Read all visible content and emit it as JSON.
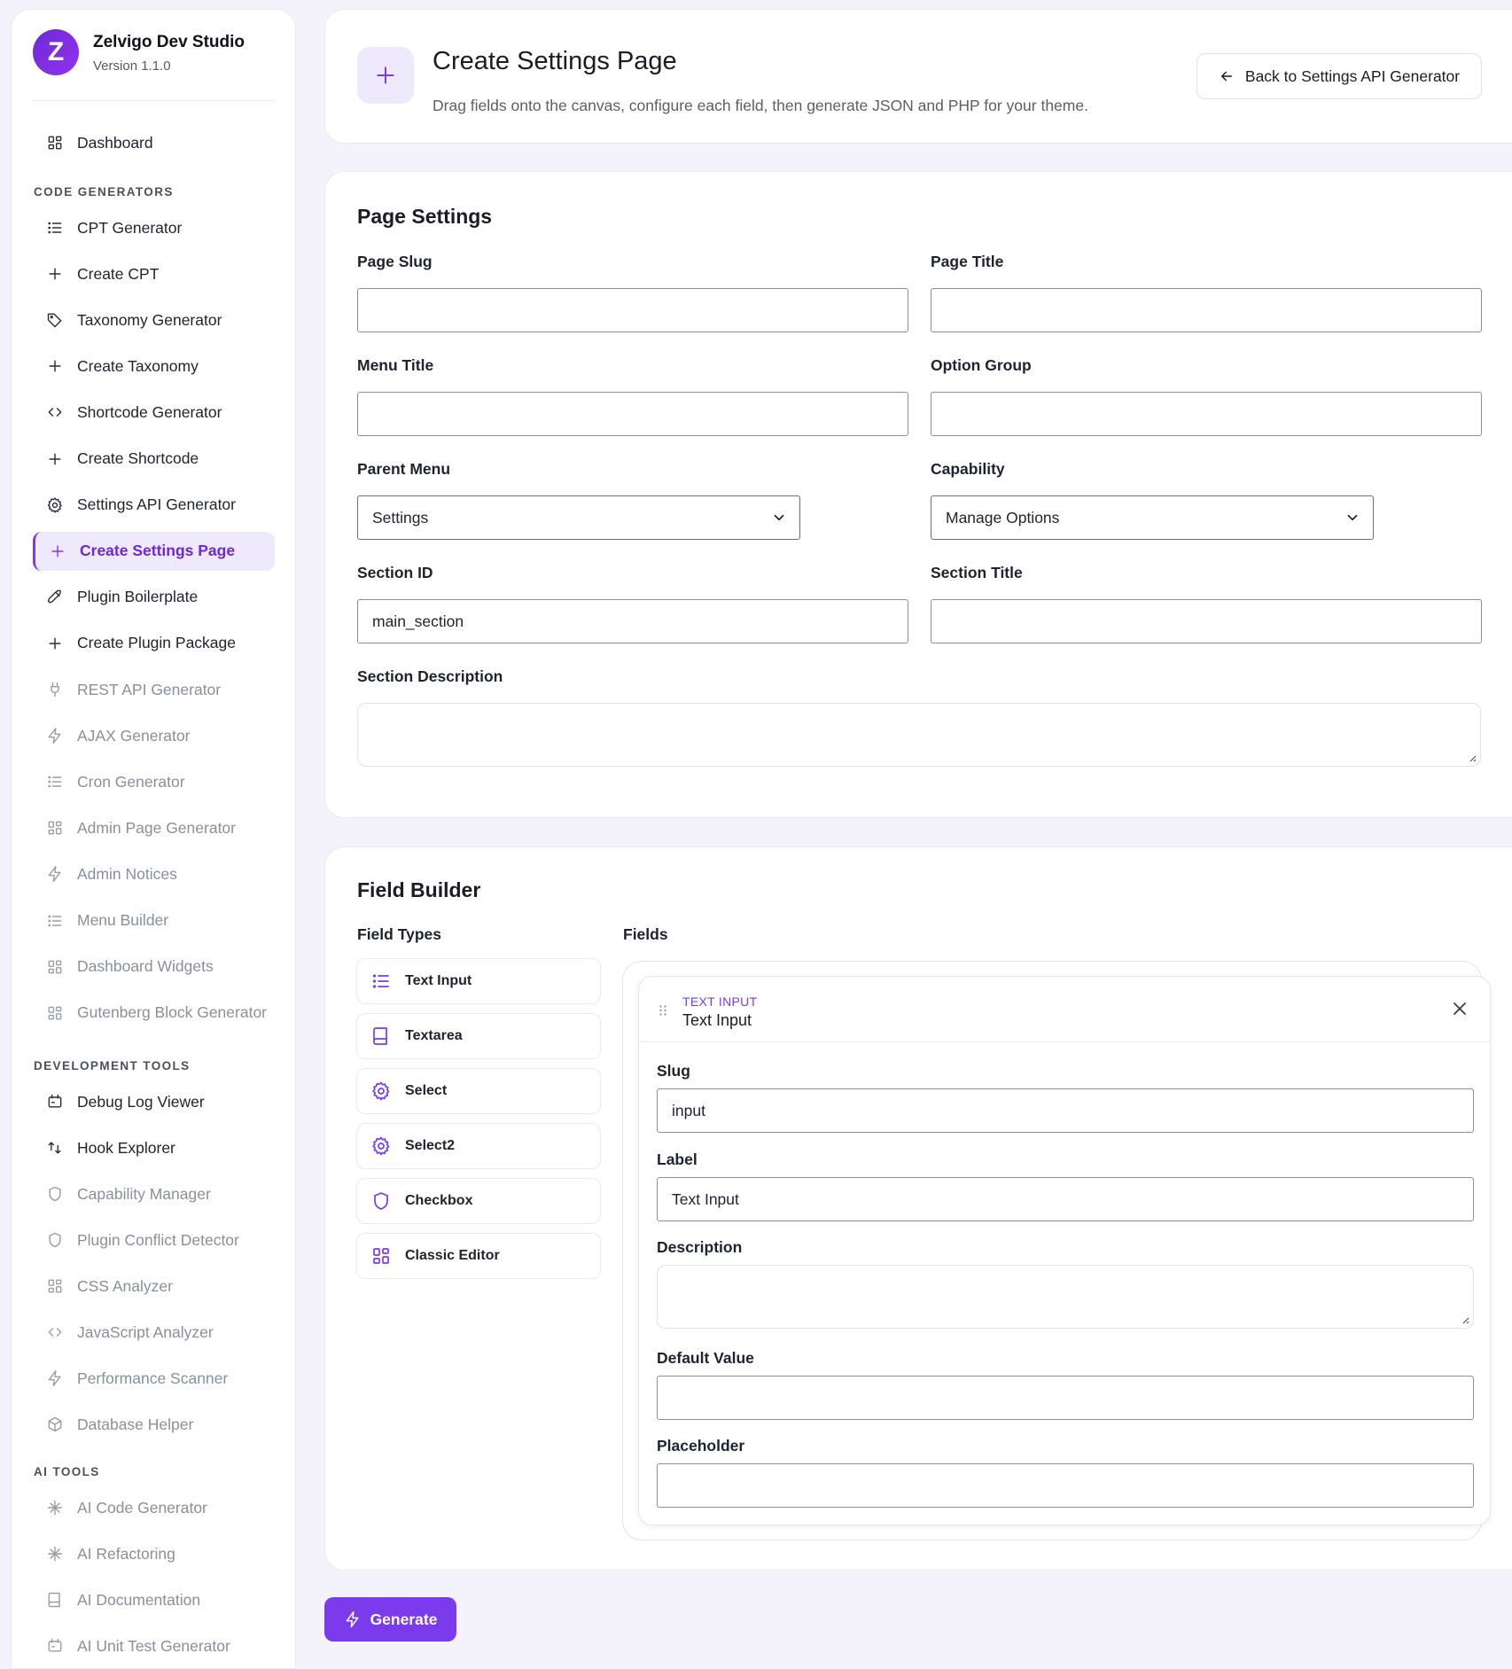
{
  "brand": {
    "logo_letter": "Z",
    "name": "Zelvigo Dev Studio",
    "version": "Version 1.1.0"
  },
  "nav": {
    "dashboard": "Dashboard",
    "sections": {
      "code": "CODE GENERATORS",
      "dev": "DEVELOPMENT TOOLS",
      "ai": "AI TOOLS"
    },
    "code_items": [
      {
        "label": "CPT Generator",
        "icon": "list-icon"
      },
      {
        "label": "Create CPT",
        "icon": "plus-icon"
      },
      {
        "label": "Taxonomy Generator",
        "icon": "tag-icon"
      },
      {
        "label": "Create Taxonomy",
        "icon": "plus-icon"
      },
      {
        "label": "Shortcode Generator",
        "icon": "code-icon"
      },
      {
        "label": "Create Shortcode",
        "icon": "plus-icon"
      },
      {
        "label": "Settings API Generator",
        "icon": "gear-icon"
      },
      {
        "label": "Create Settings Page",
        "icon": "plus-icon"
      },
      {
        "label": "Plugin Boilerplate",
        "icon": "rocket-icon"
      },
      {
        "label": "Create Plugin Package",
        "icon": "plus-icon"
      },
      {
        "label": "REST API Generator",
        "icon": "plug-icon"
      },
      {
        "label": "AJAX Generator",
        "icon": "bolt-icon"
      },
      {
        "label": "Cron Generator",
        "icon": "list-icon"
      },
      {
        "label": "Admin Page Generator",
        "icon": "grid-icon"
      },
      {
        "label": "Admin Notices",
        "icon": "bolt-icon"
      },
      {
        "label": "Menu Builder",
        "icon": "list-icon"
      },
      {
        "label": "Dashboard Widgets",
        "icon": "grid-icon"
      },
      {
        "label": "Gutenberg Block Generator",
        "icon": "grid-icon"
      }
    ],
    "dev_items": [
      {
        "label": "Debug Log Viewer",
        "icon": "calendar-icon"
      },
      {
        "label": "Hook Explorer",
        "icon": "hook-icon"
      },
      {
        "label": "Capability Manager",
        "icon": "shield-icon"
      },
      {
        "label": "Plugin Conflict Detector",
        "icon": "shield-icon"
      },
      {
        "label": "CSS Analyzer",
        "icon": "grid-icon"
      },
      {
        "label": "JavaScript Analyzer",
        "icon": "code-icon"
      },
      {
        "label": "Performance Scanner",
        "icon": "bolt-icon"
      },
      {
        "label": "Database Helper",
        "icon": "cube-icon"
      }
    ],
    "ai_items": [
      {
        "label": "AI Code Generator",
        "icon": "sparkle-icon"
      },
      {
        "label": "AI Refactoring",
        "icon": "sparkle-icon"
      },
      {
        "label": "AI Documentation",
        "icon": "book-icon"
      },
      {
        "label": "AI Unit Test Generator",
        "icon": "calendar-icon"
      }
    ],
    "active": "Create Settings Page"
  },
  "header": {
    "title": "Create Settings Page",
    "subtitle": "Drag fields onto the canvas, configure each field, then generate JSON and PHP for your theme.",
    "back_label": "Back to Settings API Generator"
  },
  "page_settings": {
    "title": "Page Settings",
    "page_slug": {
      "label": "Page Slug",
      "value": ""
    },
    "page_title": {
      "label": "Page Title",
      "value": ""
    },
    "menu_title": {
      "label": "Menu Title",
      "value": ""
    },
    "option_group": {
      "label": "Option Group",
      "value": ""
    },
    "parent_menu": {
      "label": "Parent Menu",
      "value": "Settings"
    },
    "capability": {
      "label": "Capability",
      "value": "Manage Options"
    },
    "section_id": {
      "label": "Section ID",
      "value": "main_section"
    },
    "section_title": {
      "label": "Section Title",
      "value": ""
    },
    "section_description": {
      "label": "Section Description",
      "value": ""
    }
  },
  "field_builder": {
    "title": "Field Builder",
    "types_label": "Field Types",
    "fields_label": "Fields",
    "types": [
      {
        "label": "Text Input",
        "icon": "list-icon"
      },
      {
        "label": "Textarea",
        "icon": "book-icon"
      },
      {
        "label": "Select",
        "icon": "gear-icon"
      },
      {
        "label": "Select2",
        "icon": "gear-icon"
      },
      {
        "label": "Checkbox",
        "icon": "shield-icon"
      },
      {
        "label": "Classic Editor",
        "icon": "grid-icon"
      }
    ],
    "field": {
      "kind": "TEXT INPUT",
      "name": "Text Input",
      "slug": {
        "label": "Slug",
        "value": "input"
      },
      "label": {
        "label": "Label",
        "value": "Text Input"
      },
      "description": {
        "label": "Description",
        "value": ""
      },
      "default": {
        "label": "Default Value",
        "value": ""
      },
      "placeholder": {
        "label": "Placeholder",
        "value": ""
      }
    }
  },
  "generate_label": "Generate",
  "colors": {
    "accent": "#7c3aed",
    "accent_light": "#efe9fd",
    "background": "#f4f3fb"
  }
}
